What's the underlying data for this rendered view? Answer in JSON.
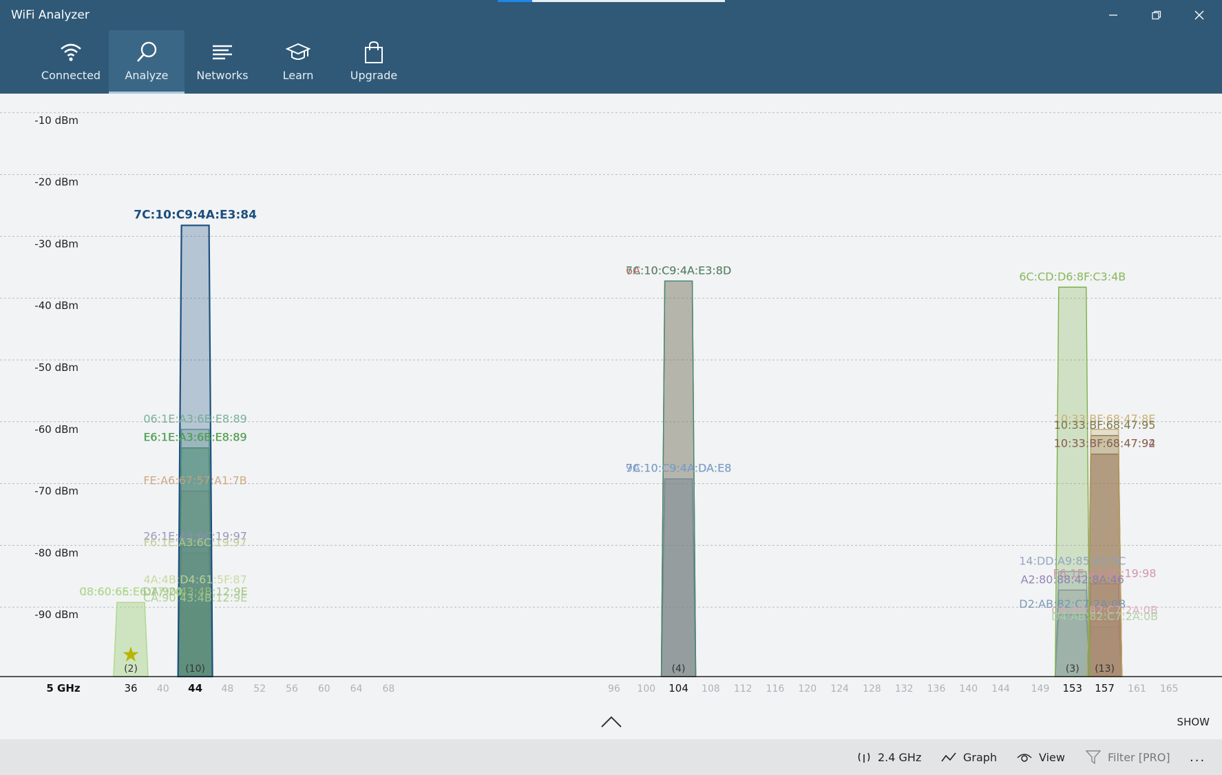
{
  "app": {
    "title": "WiFi Analyzer"
  },
  "window_controls": {
    "minimize": "—",
    "maximize": "❐",
    "close": "✕"
  },
  "loading": {
    "progress": 0.15
  },
  "tabs": [
    {
      "label": "Connected",
      "icon": "wifi-icon",
      "active": false
    },
    {
      "label": "Analyze",
      "icon": "magnifier-icon",
      "active": true
    },
    {
      "label": "Networks",
      "icon": "list-icon",
      "active": false
    },
    {
      "label": "Learn",
      "icon": "graduation-cap-icon",
      "active": false
    },
    {
      "label": "Upgrade",
      "icon": "shopping-bag-icon",
      "active": false
    }
  ],
  "chart_data": {
    "type": "bar",
    "band_label": "5 GHz",
    "ylim": [
      -100,
      -6
    ],
    "yticks": [
      -10,
      -20,
      -30,
      -40,
      -50,
      -60,
      -70,
      -80,
      -90
    ],
    "ytick_labels": [
      "-10 dBm",
      "-20 dBm",
      "-30 dBm",
      "-40 dBm",
      "-50 dBm",
      "-60 dBm",
      "-70 dBm",
      "-80 dBm",
      "-90 dBm"
    ],
    "x_channels": [
      36,
      40,
      44,
      48,
      52,
      56,
      60,
      64,
      68,
      96,
      100,
      104,
      108,
      112,
      116,
      120,
      124,
      128,
      132,
      136,
      140,
      144,
      149,
      153,
      157,
      161,
      165
    ],
    "active_channels": [
      36,
      44,
      104,
      153,
      157
    ],
    "channel_counts": [
      {
        "channel": 36,
        "label": "(2)",
        "connected": true
      },
      {
        "channel": 44,
        "label": "(10)"
      },
      {
        "channel": 104,
        "label": "(4)"
      },
      {
        "channel": 153,
        "label": "(3)"
      },
      {
        "channel": 157,
        "label": "(13)"
      }
    ],
    "networks": [
      {
        "label": "08:60:6E:E6:77:24",
        "channel": 36,
        "dbm": -88,
        "color": "#9ccf86"
      },
      {
        "label": "C8:60:65:E6:77:20",
        "channel": 36,
        "dbm": -88,
        "color": "#b3d98f"
      },
      {
        "label": "7C:10:C9:4A:E3:84",
        "channel": 44,
        "dbm": -27,
        "color": "#1b4f7d",
        "bold": true
      },
      {
        "label": "06:1E:A3:6B:E8:89",
        "channel": 44,
        "dbm": -60,
        "color": "#6aa88e"
      },
      {
        "label": "E6:1E:A3:6B:E8:89",
        "channel": 44,
        "dbm": -63,
        "color": "#2e8b57"
      },
      {
        "label": "F6:1E:A3:6B:E8:89",
        "channel": 44,
        "dbm": -63,
        "color": "#55a14a"
      },
      {
        "label": "FE:A6:67:57:A1:7B",
        "channel": 44,
        "dbm": -70,
        "color": "#c9a27a"
      },
      {
        "label": "26:1E:A3:6C:19:97",
        "channel": 44,
        "dbm": -79,
        "color": "#8c8fb8"
      },
      {
        "label": "F6:1E:A3:6C:19:97",
        "channel": 44,
        "dbm": -80,
        "color": "#b9c98d"
      },
      {
        "label": "4A:4B:D4:61:5F:87",
        "channel": 44,
        "dbm": -86,
        "color": "#c4d69a"
      },
      {
        "label": "DA:90:43:4B:12:9E",
        "channel": 44,
        "dbm": -88,
        "color": "#9cbf7a"
      },
      {
        "label": "CA:90:43:4B:12:9E",
        "channel": 44,
        "dbm": -89,
        "color": "#a9cc8c"
      },
      {
        "label": "6A:10:C9:4A:E3:8D",
        "channel": 104,
        "dbm": -36,
        "color": "#c0504d"
      },
      {
        "label": "7C:10:C9:4A:E3:8D",
        "channel": 104,
        "dbm": -36,
        "color": "#3e8c6c"
      },
      {
        "label": "7C:10:C9:4A:DA:E8",
        "channel": 104,
        "dbm": -68,
        "color": "#6a82b8"
      },
      {
        "label": "9A:10:C9:4A:DA:E8",
        "channel": 104,
        "dbm": -68,
        "color": "#7aa0c8"
      },
      {
        "label": "6C:CD:D6:8F:C3:4B",
        "channel": 153,
        "dbm": -37,
        "color": "#7bb04a"
      },
      {
        "label": "10:33:BF:68:47:8E",
        "channel": 157,
        "dbm": -60,
        "color": "#c6a96a"
      },
      {
        "label": "10:33:BF:68:47:95",
        "channel": 157,
        "dbm": -61,
        "color": "#6e6a3a"
      },
      {
        "label": "10:33:BF:68:47:92",
        "channel": 157,
        "dbm": -64,
        "color": "#8e3a6e"
      },
      {
        "label": "10:33:BF:68:47:94",
        "channel": 157,
        "dbm": -64,
        "color": "#8a6a4a"
      },
      {
        "label": "14:DD:A9:85:41:5C",
        "channel": 153,
        "dbm": -83,
        "color": "#8a9fc0"
      },
      {
        "label": "F6:1E:A3:6C:19:98",
        "channel": 157,
        "dbm": -85,
        "color": "#d18aa6"
      },
      {
        "label": "A2:80:88:42:8A:46",
        "channel": 153,
        "dbm": -86,
        "color": "#8a78b0"
      },
      {
        "label": "D2:AB:82:C7:2A:0B",
        "channel": 153,
        "dbm": -90,
        "color": "#7090b0"
      },
      {
        "label": "CA:AB:82:C7:2A:0B",
        "channel": 157,
        "dbm": -91,
        "color": "#d9a8b8"
      },
      {
        "label": "D4:AB:82:C7:2A:0B",
        "channel": 157,
        "dbm": -92,
        "color": "#a8cfa0"
      }
    ],
    "grid": true
  },
  "panel": {
    "show_label": "SHOW"
  },
  "bottom_bar": [
    {
      "label": "2.4 GHz",
      "icon": "antenna-icon",
      "enabled": true
    },
    {
      "label": "Graph",
      "icon": "graph-icon",
      "enabled": true
    },
    {
      "label": "View",
      "icon": "eye-icon",
      "enabled": true
    },
    {
      "label": "Filter [PRO]",
      "icon": "filter-icon",
      "enabled": false
    }
  ],
  "more_label": "..."
}
